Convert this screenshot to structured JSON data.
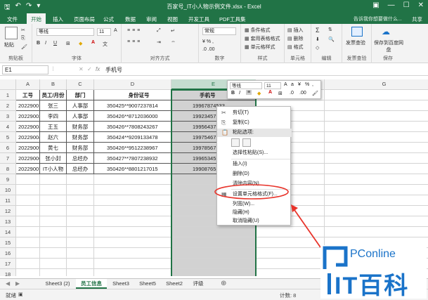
{
  "app": {
    "title": "百家号_IT小人物示例文件.xlsx - Excel",
    "qat_icons": [
      "save-icon",
      "undo-icon",
      "redo-icon",
      "customize-icon"
    ]
  },
  "tabs": {
    "items": [
      "文件",
      "开始",
      "插入",
      "页面布局",
      "公式",
      "数据",
      "审阅",
      "视图",
      "开发工具",
      "PDF工具集"
    ],
    "active": "开始",
    "help": "告诉我你想要做什么...",
    "share": "共享"
  },
  "ribbon": {
    "clipboard": {
      "label": "剪贴板",
      "paste": "粘贴"
    },
    "font": {
      "label": "字体",
      "name": "等线",
      "size": "11"
    },
    "alignment": {
      "label": "对齐方式"
    },
    "number": {
      "label": "数字",
      "format": "常规"
    },
    "styles": {
      "label": "样式",
      "cond_format": "条件格式",
      "table_format": "套用表格格式",
      "cell_styles": "单元格样式"
    },
    "cells": {
      "label": "单元格",
      "insert": "插入",
      "delete": "删除",
      "format": "格式"
    },
    "editing": {
      "label": "编辑"
    },
    "invoice": {
      "label": "发票查验",
      "btn": "发票查验"
    },
    "save_baidu": {
      "label": "保存",
      "btn": "保存到百度网盘"
    }
  },
  "formula_bar": {
    "name_box": "E1",
    "fx": "fx",
    "value": "手机号"
  },
  "grid": {
    "columns": [
      "A",
      "B",
      "C",
      "D",
      "E",
      "F",
      "G"
    ],
    "rows": [
      "1",
      "2",
      "3",
      "4",
      "5",
      "6",
      "7",
      "8",
      "9",
      "10",
      "11",
      "12",
      "13",
      "14",
      "15",
      "16",
      "17",
      "18"
    ],
    "headers": [
      "工号",
      "员工/月份",
      "部门",
      "身份证号",
      "手机号"
    ],
    "data": [
      [
        "20229001",
        "张三",
        "人事部",
        "350425**9007237814",
        "19967874533"
      ],
      [
        "20229002",
        "李四",
        "人事部",
        "350426**8712036000",
        "19923457"
      ],
      [
        "20229003",
        "王五",
        "财务部",
        "350426**7808243267",
        "19956437"
      ],
      [
        "20229004",
        "赵六",
        "财务部",
        "350424**9209133478",
        "19975467"
      ],
      [
        "20229005",
        "黄七",
        "财务部",
        "350426**9512238967",
        "19978567"
      ],
      [
        "20229006",
        "张小封",
        "总经办",
        "350427**7807238932",
        "19965345"
      ],
      [
        "20229007",
        "IT小人物",
        "总经办",
        "350426**8801217015",
        "19908765"
      ]
    ]
  },
  "mini_toolbar": {
    "font": "等线",
    "size": "11",
    "percent": "%"
  },
  "context_menu": {
    "items": [
      "剪切(T)",
      "复制(C)",
      "粘贴选项:",
      "选择性粘贴(S)...",
      "插入(I)",
      "删除(D)",
      "清除内容(N)",
      "设置单元格格式(F)...",
      "列宽(W)...",
      "隐藏(H)",
      "取消隐藏(U)"
    ],
    "highlighted": "设置单元格格式(F)..."
  },
  "sheets": {
    "tabs": [
      "Sheet3 (2)",
      "员工信息",
      "Sheet3",
      "Sheet5",
      "Sheet2",
      "评级"
    ],
    "active": "员工信息"
  },
  "status": {
    "ready": "就绪",
    "count": "计数: 8"
  },
  "logo": {
    "top": "PConline",
    "bottom": "IT百科"
  },
  "colors": {
    "accent": "#217346",
    "annotation": "#e8332a",
    "logo": "#1a73c9"
  }
}
